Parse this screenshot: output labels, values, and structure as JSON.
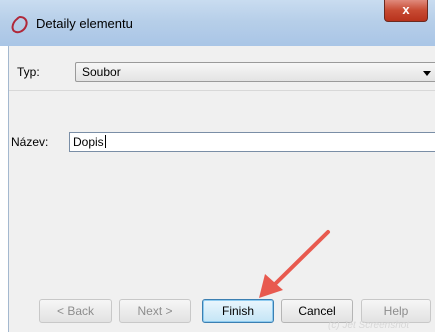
{
  "window": {
    "title": "Detaily elementu",
    "close_glyph": "x"
  },
  "form": {
    "type_label": "Typ:",
    "type_value": "Soubor",
    "name_label": "Název:",
    "name_value": "Dopis"
  },
  "buttons": {
    "back": "< Back",
    "next": "Next >",
    "finish": "Finish",
    "cancel": "Cancel",
    "help": "Help"
  },
  "annotation": {
    "color": "#e85a4f"
  },
  "watermark": "(c) Jet Screenshot"
}
